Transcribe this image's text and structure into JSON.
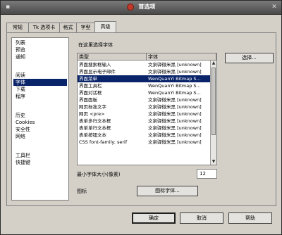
{
  "window": {
    "title": "首选项",
    "menu_icon": "window-menu-icon",
    "close_icon": "close-icon"
  },
  "tabs": [
    {
      "label": "常规"
    },
    {
      "label": "Tk 选项卡"
    },
    {
      "label": "格式"
    },
    {
      "label": "字型"
    },
    {
      "label": "高级"
    }
  ],
  "categories": [
    {
      "label": "列表"
    },
    {
      "label": "预览"
    },
    {
      "label": "通知"
    },
    {
      "label": "阅读"
    },
    {
      "label": "字体"
    },
    {
      "label": "下载"
    },
    {
      "label": "程序"
    },
    {
      "label": "历史"
    },
    {
      "label": "Cookies"
    },
    {
      "label": "安全性"
    },
    {
      "label": "网络"
    },
    {
      "label": "工具栏"
    },
    {
      "label": "快捷键"
    }
  ],
  "fonts_section": {
    "heading": "在这里选择字体",
    "select_button": "选择...",
    "columns": {
      "type": "类型",
      "font": "字体"
    },
    "rows": [
      {
        "type": "界面搜索框输入",
        "font": "文泉驿微米黑 [unknown]"
      },
      {
        "type": "界面显示电子邮件",
        "font": "文泉驿微米黑 [unknown]"
      },
      {
        "type": "界面菜单",
        "font": "WenQuanYi Bitmap S..."
      },
      {
        "type": "界面工具栏",
        "font": "WenQuanYi Bitmap S..."
      },
      {
        "type": "界面对话框",
        "font": "WenQuanYi Bitmap S..."
      },
      {
        "type": "界面面板",
        "font": "文泉驿微米黑 [unknown]"
      },
      {
        "type": "网页标准文字",
        "font": "文泉驿微米黑 [unknown]"
      },
      {
        "type": "网页 <pre>",
        "font": "文泉驿微米黑 [unknown]"
      },
      {
        "type": "表单多行文本框",
        "font": "文泉驿微米黑 [unknown]"
      },
      {
        "type": "表单单行文本框",
        "font": "文泉驿微米黑 [unknown]"
      },
      {
        "type": "表单按钮文本",
        "font": "文泉驿微米黑 [unknown]"
      },
      {
        "type": "CSS font-family: serif",
        "font": "文泉驿微米黑 [unknown]"
      }
    ],
    "selected_row": 2,
    "min_size_label": "最小字体大小(像素)",
    "min_size_value": "12",
    "font_label": "图标",
    "font_button": "图标字体..."
  },
  "buttons": {
    "ok": "确定",
    "cancel": "取消",
    "help": "帮助"
  }
}
